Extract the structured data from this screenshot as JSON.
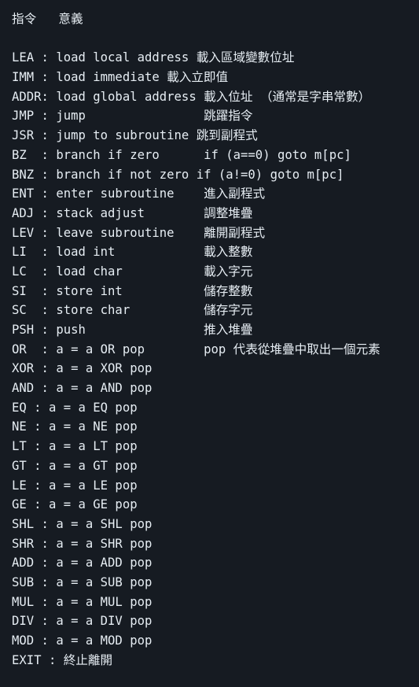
{
  "lines": [
    "指令   意義",
    "",
    "LEA : load local address 載入區域變數位址",
    "IMM : load immediate 載入立即值",
    "ADDR: load global address 載入位址 （通常是字串常數）",
    "JMP : jump                跳躍指令",
    "JSR : jump to subroutine 跳到副程式",
    "BZ  : branch if zero      if (a==0) goto m[pc]",
    "BNZ : branch if not zero if (a!=0) goto m[pc]",
    "ENT : enter subroutine    進入副程式",
    "ADJ : stack adjust        調整堆疊",
    "LEV : leave subroutine    離開副程式",
    "LI  : load int            載入整數",
    "LC  : load char           載入字元",
    "SI  : store int           儲存整數",
    "SC  : store char          儲存字元",
    "PSH : push                推入堆疊",
    "OR  : a = a OR pop        pop 代表從堆疊中取出一個元素",
    "XOR : a = a XOR pop",
    "AND : a = a AND pop",
    "EQ : a = a EQ pop",
    "NE : a = a NE pop",
    "LT : a = a LT pop",
    "GT : a = a GT pop",
    "LE : a = a LE pop",
    "GE : a = a GE pop",
    "SHL : a = a SHL pop",
    "SHR : a = a SHR pop",
    "ADD : a = a ADD pop",
    "SUB : a = a SUB pop",
    "MUL : a = a MUL pop",
    "DIV : a = a DIV pop",
    "MOD : a = a MOD pop",
    "EXIT : 終止離開"
  ]
}
